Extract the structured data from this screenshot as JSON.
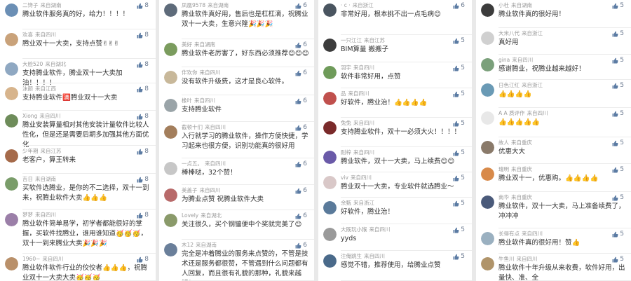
{
  "columns": [
    {
      "comments": [
        {
          "user": "二馋子",
          "src": "来自湖南",
          "text": "腾业软件服务真的好，给力！！！！",
          "likes": "8",
          "avatar_color": "#6b8fb5"
        },
        {
          "user": "欢喜",
          "src": "来自四川",
          "text": "腾业双十一大卖，支持点赞✌✌✌",
          "likes": "8",
          "avatar_color": "#c9a27a"
        },
        {
          "user": "大脸520",
          "src": "来自湖北",
          "text": "支持腾业软件，腾业双十一大卖加油！！！！",
          "likes": "8",
          "avatar_color": "#8fa8c2"
        },
        {
          "user": "沫颜",
          "src": "来自江西",
          "text": "支持腾业软件🈵腾业双十一大卖",
          "likes": "8",
          "avatar_color": "#d7b48c"
        },
        {
          "user": "Xiong",
          "src": "来自四川",
          "text": "腾业安装算量相对其他安装计量软件比较人性化，但是还是需要后期多加强其他方面优化",
          "likes": "8",
          "avatar_color": "#6e8c5a"
        },
        {
          "user": "少年期",
          "src": "来自江苏",
          "text": "老客户，算王转来",
          "likes": "8",
          "avatar_color": "#a56a4a"
        },
        {
          "user": "吉日",
          "src": "来自湖南",
          "text": "买软件选腾业，是你的不二选择，双十一到来，祝腾业软件大卖👍👍👍",
          "likes": "8",
          "avatar_color": "#7a9d6a"
        },
        {
          "user": "梦梦",
          "src": "来自四川",
          "text": "腾业软件简单易学，初学者都能很好的掌握，买软件找腾业，谁用谁知道🥳🥳🥳，双十一到来腾业大卖🎉🎉🎉",
          "likes": "8",
          "avatar_color": "#9b7fa8"
        },
        {
          "user": "1960~",
          "src": "来自四川",
          "text": "腾业软件软件行业的佼佼者👍👍👍，祝腾业双十一大卖大卖🥳🥳🥳",
          "likes": "8",
          "avatar_color": "#b9906a"
        }
      ]
    },
    {
      "comments": [
        {
          "user": "凤凰9578",
          "src": "来自湖南",
          "text": "腾业软件真好用，售后也是杠杠滴，祝腾业双十一大卖，生意兴隆🎉🎉🎉",
          "likes": "6",
          "avatar_color": "#5e6b7a"
        },
        {
          "user": "美好",
          "src": "来自湖南",
          "text": "腾业软件老厉害了，好东西必须推荐😊😊😊",
          "likes": "6",
          "avatar_color": "#7b9c5e"
        },
        {
          "user": "伴欢你",
          "src": "来自四川",
          "text": "没有软件升级费，这才是良心软件。",
          "likes": "6",
          "avatar_color": "#c8b89a"
        },
        {
          "user": "橡叶",
          "src": "来自四川",
          "text": "支持腾业软件",
          "likes": "6",
          "avatar_color": "#9aa4a8"
        },
        {
          "user": "截顿十们",
          "src": "来自四川",
          "text": "入行就学习的腾业软件，操作方便快捷，学习起来也很方便，识别功能真的很好用",
          "likes": "6",
          "avatar_color": "#a37e5c"
        },
        {
          "user": "一点五。",
          "src": "来自四川",
          "text": "棒棒哒，32个赞！",
          "likes": "6",
          "avatar_color": "#c7c7c7"
        },
        {
          "user": "美盖子",
          "src": "来自四川",
          "text": "为腾业点赞 祝腾业软件大卖",
          "likes": "6",
          "avatar_color": "#b86a6a"
        },
        {
          "user": "Lovely",
          "src": "来自湖北",
          "text": "关注很久，买个钢镚便中个奖就完美了😊",
          "likes": "6",
          "avatar_color": "#8a9a6a"
        },
        {
          "user": "木12",
          "src": "来自湖南",
          "text": "完全是冲着腾业的服务来点赞的，不管是技术还是服务都很赞，不管遇到什么问题都有人回复，而且很有礼貌的那种，礼貌来越好！",
          "likes": "6",
          "avatar_color": "#6a7f9a"
        }
      ]
    },
    {
      "comments": [
        {
          "user": "· c ·",
          "src": "来自浙江",
          "text": "非常好用，根本挑不出一点毛病😊",
          "likes": "6",
          "avatar_color": "#4a5560"
        },
        {
          "user": "一只江江",
          "src": "来自江苏",
          "text": "BIM算量 搬搬子",
          "likes": "5",
          "avatar_color": "#3c3c3c"
        },
        {
          "user": "羽宇",
          "src": "来自四川",
          "text": "软件非常好用，点赞",
          "likes": "5",
          "avatar_color": "#6f9b5a"
        },
        {
          "user": "品",
          "src": "来自四川",
          "text": "好软件，腾业治！👍👍👍👍",
          "likes": "5",
          "avatar_color": "#c0504d"
        },
        {
          "user": "兔兔",
          "src": "来自四川",
          "text": "支持腾业软件，双十一必须大火！！！！",
          "likes": "5",
          "avatar_color": "#7a2a2a"
        },
        {
          "user": "耐梓",
          "src": "来自四川",
          "text": "腾业软件，双十一大卖，马上续费😊😊",
          "likes": "5",
          "avatar_color": "#6a5aa8"
        },
        {
          "user": "viv",
          "src": "来自四川",
          "text": "腾业双十一大卖，专业软件就选腾业～",
          "likes": "5",
          "avatar_color": "#d9c8c8"
        },
        {
          "user": "余甄",
          "src": "来自浙江",
          "text": "好软件，腾业治！",
          "likes": "5",
          "avatar_color": "#5a7a9a"
        },
        {
          "user": "大既玩小猴",
          "src": "来自四川",
          "text": "yyds",
          "likes": "5",
          "avatar_color": "#9a9a9a"
        },
        {
          "user": "注俺跳生",
          "src": "来自四川",
          "text": "感觉不错，推荐使用，给腾业点赞",
          "likes": "5",
          "avatar_color": "#4a6a8a"
        }
      ]
    },
    {
      "comments": [
        {
          "user": "小杜",
          "src": "来自湖南",
          "text": "腾业软件真的很好用！",
          "likes": "5",
          "avatar_color": "#3c3c3c"
        },
        {
          "user": "大米八代",
          "src": "来自浙江",
          "text": "真好用",
          "likes": "5",
          "avatar_color": "#d0d0d0"
        },
        {
          "user": "gina",
          "src": "来自四川",
          "text": "感谢腾业，祝腾业越来越好！",
          "likes": "5",
          "avatar_color": "#7ba07b"
        },
        {
          "user": "日色江红",
          "src": "来自浙江",
          "text": "👍👍👍👍",
          "likes": "5",
          "avatar_color": "#6a9ab5"
        },
        {
          "user": "A A 质评作",
          "src": "来自四川",
          "text": "👍👍👍👍👍",
          "likes": "5",
          "avatar_color": "#e8e8e8"
        },
        {
          "user": "故人",
          "src": "来自重庆",
          "text": "优惠大大",
          "likes": "5",
          "avatar_color": "#8a7a6a"
        },
        {
          "user": "瑞明",
          "src": "来自重庆",
          "text": "腾业双十一，优惠购。👍👍👍👍",
          "likes": "5",
          "avatar_color": "#d88a4a"
        },
        {
          "user": "南华",
          "src": "来自重庆",
          "text": "腾业软件，双十一大卖，马上准备续费了，冲冲冲",
          "likes": "5",
          "avatar_color": "#4a5a7a"
        },
        {
          "user": "长得有点",
          "src": "来自四川",
          "text": "腾业软件真的很好用！赞👍",
          "likes": "5",
          "avatar_color": "#9ab0c0"
        },
        {
          "user": "牛鱼川",
          "src": "来自四川",
          "text": "腾业软件十年升级从来收费，软件好用，出量快、准、全",
          "likes": "5",
          "avatar_color": "#b0946a"
        }
      ]
    }
  ]
}
